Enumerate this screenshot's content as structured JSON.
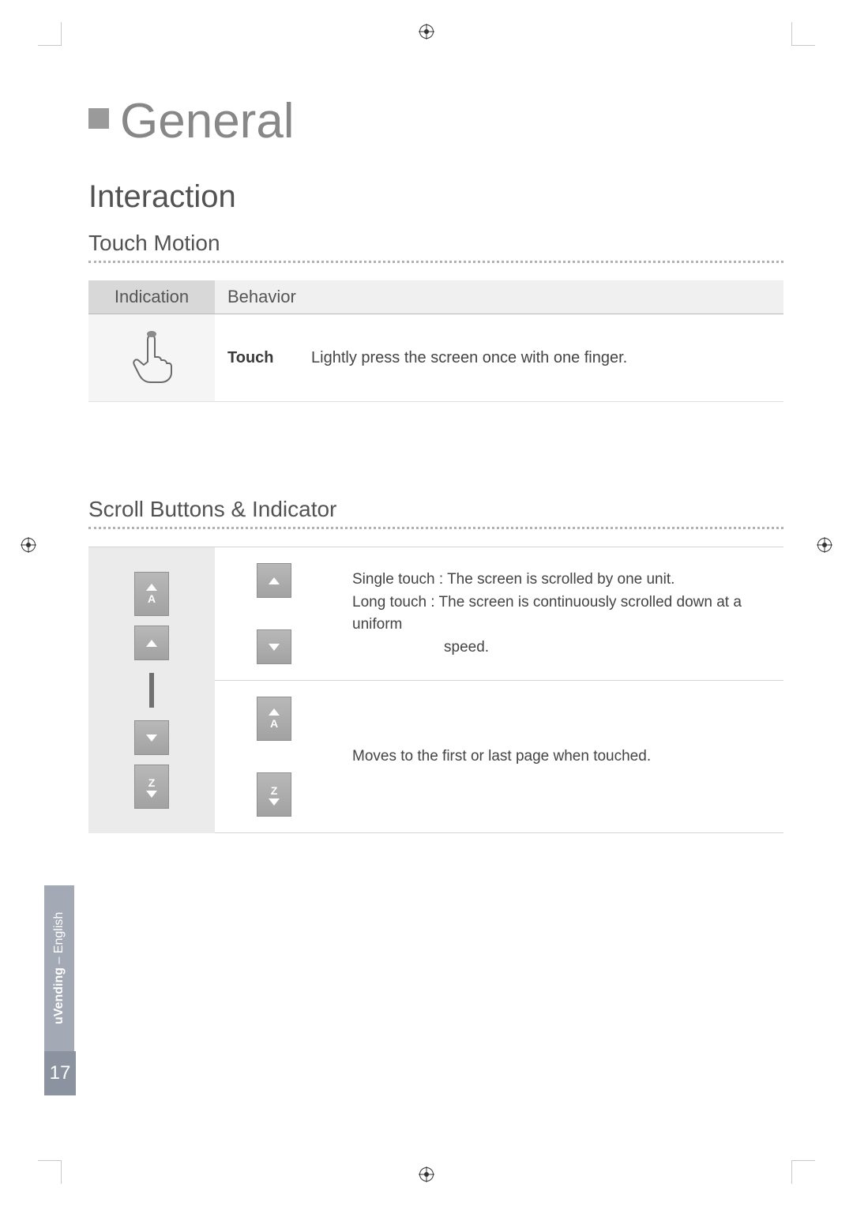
{
  "chapter": {
    "title": "General"
  },
  "section": {
    "title": "Interaction"
  },
  "touch_motion": {
    "heading": "Touch Motion",
    "header": {
      "indication": "Indication",
      "behavior": "Behavior"
    },
    "row": {
      "name": "Touch",
      "description": "Lightly press the screen once with one finger."
    }
  },
  "scroll_section": {
    "heading": "Scroll Buttons & Indicator",
    "row1": {
      "single_label": "Single touch :",
      "single_desc": "The screen is scrolled by one unit.",
      "long_label": "Long touch :",
      "long_desc": "The screen is continuously scrolled down at a uniform",
      "long_desc2": "speed."
    },
    "row2": {
      "desc": "Moves to the first or last page when touched."
    },
    "icons": {
      "top_letter": "A",
      "bottom_letter": "Z"
    }
  },
  "side_tab": {
    "product": "uVending",
    "separator": "–",
    "language": "English",
    "page_number": "17"
  }
}
